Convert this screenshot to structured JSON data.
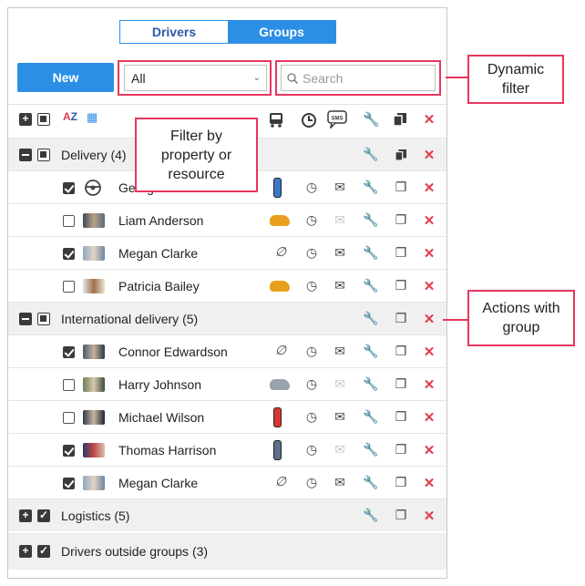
{
  "tabs": [
    {
      "label": "Drivers",
      "active": false
    },
    {
      "label": "Groups",
      "active": true
    }
  ],
  "toolbar": {
    "new_label": "New",
    "filter_value": "All",
    "search_placeholder": "Search"
  },
  "callouts": {
    "dynamic_filter": "Dynamic filter",
    "filter_by": "Filter by property or resource",
    "actions": "Actions with group"
  },
  "column_icons": [
    "bus-icon",
    "history-icon",
    "sms-icon",
    "wrench-icon",
    "copy-icon",
    "delete-icon"
  ],
  "groups": [
    {
      "name": "Delivery (4)",
      "drivers": [
        {
          "name": "George",
          "checked": true,
          "photo": "wheel",
          "unit": "phone-blue",
          "msg": true
        },
        {
          "name": "Liam Anderson",
          "checked": false,
          "photo": "photo",
          "unit": "car-orange",
          "msg": false
        },
        {
          "name": "Megan Clarke",
          "checked": true,
          "photo": "photo",
          "unit": "none",
          "msg": true
        },
        {
          "name": "Patricia Bailey",
          "checked": false,
          "photo": "photo",
          "unit": "car-orange",
          "msg": true
        }
      ]
    },
    {
      "name": "International delivery (5)",
      "drivers": [
        {
          "name": "Connor Edwardson",
          "checked": true,
          "photo": "photo",
          "unit": "none",
          "msg": true
        },
        {
          "name": "Harry Johnson",
          "checked": false,
          "photo": "photo",
          "unit": "car-grey",
          "msg": false
        },
        {
          "name": "Michael Wilson",
          "checked": false,
          "photo": "photo",
          "unit": "phone-red",
          "msg": true
        },
        {
          "name": "Thomas Harrison",
          "checked": true,
          "photo": "photo",
          "unit": "phone-blue",
          "msg": false
        },
        {
          "name": "Megan Clarke",
          "checked": true,
          "photo": "photo",
          "unit": "none",
          "msg": true
        }
      ]
    },
    {
      "name": "Logistics (5)"
    },
    {
      "name": "Drivers outside groups (3)"
    }
  ],
  "colors": {
    "accent": "#2b8fe6",
    "highlight": "#e8365d",
    "delete": "#e03c4e"
  }
}
